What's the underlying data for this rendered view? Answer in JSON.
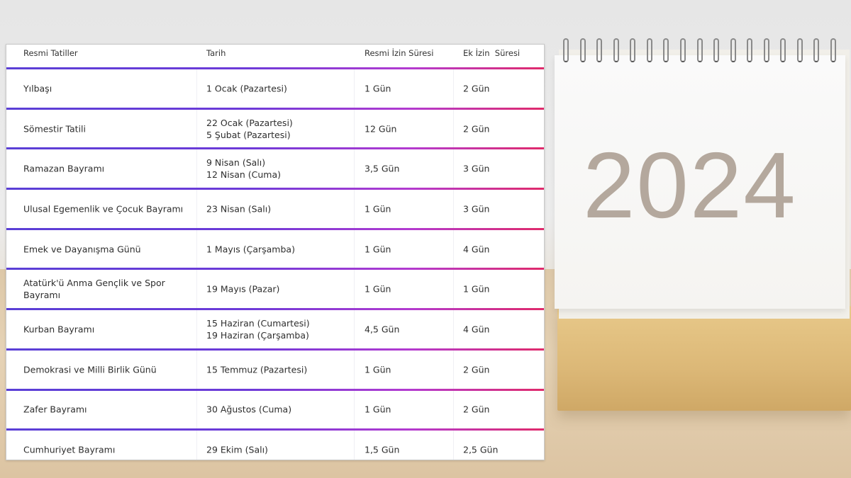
{
  "table": {
    "headers": [
      "Resmi Tatiller",
      "Tarih",
      "Resmi İzin Süresi",
      "Ek İzin  Süresi"
    ],
    "rows": [
      {
        "name": "Yılbaşı",
        "date": [
          "1 Ocak (Pazartesi)"
        ],
        "official": "1 Gün",
        "extra": "2 Gün"
      },
      {
        "name": "Sömestir Tatili",
        "date": [
          "22 Ocak (Pazartesi)",
          "5 Şubat (Pazartesi)"
        ],
        "official": "12 Gün",
        "extra": "2 Gün"
      },
      {
        "name": "Ramazan Bayramı",
        "date": [
          "9 Nisan (Salı)",
          "12 Nisan (Cuma)"
        ],
        "official": "3,5 Gün",
        "extra": "3 Gün"
      },
      {
        "name": "Ulusal Egemenlik ve Çocuk Bayramı",
        "date": [
          "23 Nisan (Salı)"
        ],
        "official": "1 Gün",
        "extra": "3 Gün"
      },
      {
        "name": "Emek ve Dayanışma Günü",
        "date": [
          "1 Mayıs (Çarşamba)"
        ],
        "official": "1 Gün",
        "extra": "4 Gün"
      },
      {
        "name": "Atatürk'ü Anma Gençlik ve Spor Bayramı",
        "date": [
          "19 Mayıs (Pazar)"
        ],
        "official": "1 Gün",
        "extra": "1 Gün"
      },
      {
        "name": "Kurban Bayramı",
        "date": [
          "15 Haziran (Cumartesi)",
          "19 Haziran (Çarşamba)"
        ],
        "official": "4,5 Gün",
        "extra": "4 Gün"
      },
      {
        "name": "Demokrasi ve Milli Birlik Günü",
        "date": [
          "15 Temmuz (Pazartesi)"
        ],
        "official": "1 Gün",
        "extra": "2 Gün"
      },
      {
        "name": "Zafer Bayramı",
        "date": [
          "30 Ağustos (Cuma)"
        ],
        "official": "1 Gün",
        "extra": "2 Gün"
      },
      {
        "name": "Cumhuriyet Bayramı",
        "date": [
          "29 Ekim (Salı)"
        ],
        "official": "1,5 Gün",
        "extra": "2,5 Gün"
      }
    ]
  },
  "calendar": {
    "year": "2024"
  },
  "colors": {
    "row_line_start": "#5a3fd6",
    "row_line_end": "#e02a6a",
    "calendar_digits": "#b4a89d",
    "calendar_base": "#dcb877"
  }
}
